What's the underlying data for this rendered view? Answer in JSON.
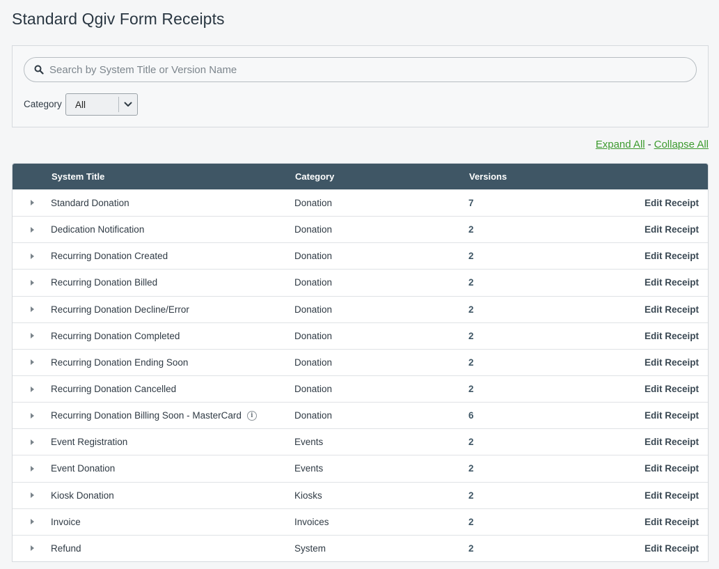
{
  "page": {
    "title": "Standard Qgiv Form Receipts"
  },
  "search": {
    "placeholder": "Search by System Title or Version Name",
    "value": ""
  },
  "filter": {
    "category_label": "Category",
    "category_value": "All"
  },
  "links": {
    "expand_all": "Expand All",
    "separator": "-",
    "collapse_all": "Collapse All"
  },
  "table": {
    "columns": {
      "title": "System Title",
      "category": "Category",
      "versions": "Versions"
    },
    "rows": [
      {
        "title": "Standard Donation",
        "category": "Donation",
        "versions": "7",
        "action": "Edit Receipt"
      },
      {
        "title": "Dedication Notification",
        "category": "Donation",
        "versions": "2",
        "action": "Edit Receipt"
      },
      {
        "title": "Recurring Donation Created",
        "category": "Donation",
        "versions": "2",
        "action": "Edit Receipt"
      },
      {
        "title": "Recurring Donation Billed",
        "category": "Donation",
        "versions": "2",
        "action": "Edit Receipt"
      },
      {
        "title": "Recurring Donation Decline/Error",
        "category": "Donation",
        "versions": "2",
        "action": "Edit Receipt"
      },
      {
        "title": "Recurring Donation Completed",
        "category": "Donation",
        "versions": "2",
        "action": "Edit Receipt"
      },
      {
        "title": "Recurring Donation Ending Soon",
        "category": "Donation",
        "versions": "2",
        "action": "Edit Receipt"
      },
      {
        "title": "Recurring Donation Cancelled",
        "category": "Donation",
        "versions": "2",
        "action": "Edit Receipt"
      },
      {
        "title": "Recurring Donation Billing Soon - MasterCard",
        "category": "Donation",
        "versions": "6",
        "action": "Edit Receipt",
        "info_icon": "info-icon"
      },
      {
        "title": "Event Registration",
        "category": "Events",
        "versions": "2",
        "action": "Edit Receipt"
      },
      {
        "title": "Event Donation",
        "category": "Events",
        "versions": "2",
        "action": "Edit Receipt"
      },
      {
        "title": "Kiosk Donation",
        "category": "Kiosks",
        "versions": "2",
        "action": "Edit Receipt"
      },
      {
        "title": "Invoice",
        "category": "Invoices",
        "versions": "2",
        "action": "Edit Receipt"
      },
      {
        "title": "Refund",
        "category": "System",
        "versions": "2",
        "action": "Edit Receipt"
      }
    ]
  },
  "colors": {
    "header_bg": "#3f5665",
    "link_green": "#3c9a2e",
    "page_bg": "#f5f6f7"
  }
}
